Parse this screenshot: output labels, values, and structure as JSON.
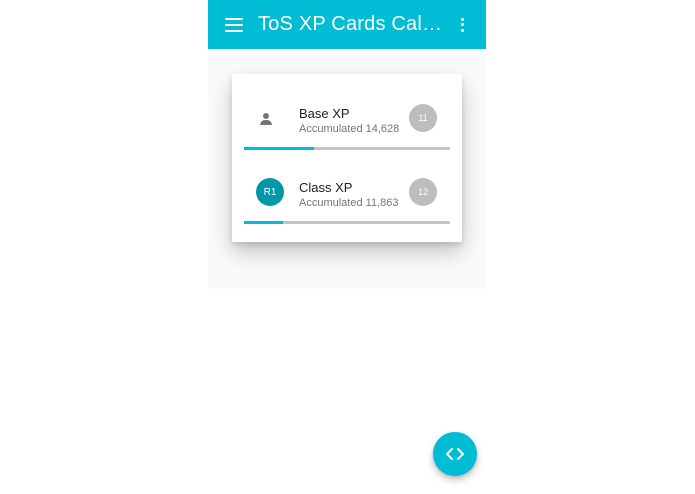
{
  "app_bar": {
    "title": "ToS XP Cards Calc…",
    "menu_icon": "menu-icon",
    "overflow_icon": "more-vert-icon",
    "background_color": "#00bcd4"
  },
  "xp_card": {
    "rows": [
      {
        "title": "Base XP",
        "subtitle": "Accumulated 14,628",
        "level": "11",
        "icon": "person-icon",
        "progress": 0.34
      },
      {
        "title": "Class XP",
        "subtitle": "Accumulated 11,863",
        "level": "12",
        "rank_label": "R1",
        "progress": 0.19
      }
    ],
    "progress_color": "#00bcd4",
    "rank_avatar_color": "#0097a7"
  },
  "fab": {
    "icon": "code-icon",
    "color": "#00bcd4"
  }
}
